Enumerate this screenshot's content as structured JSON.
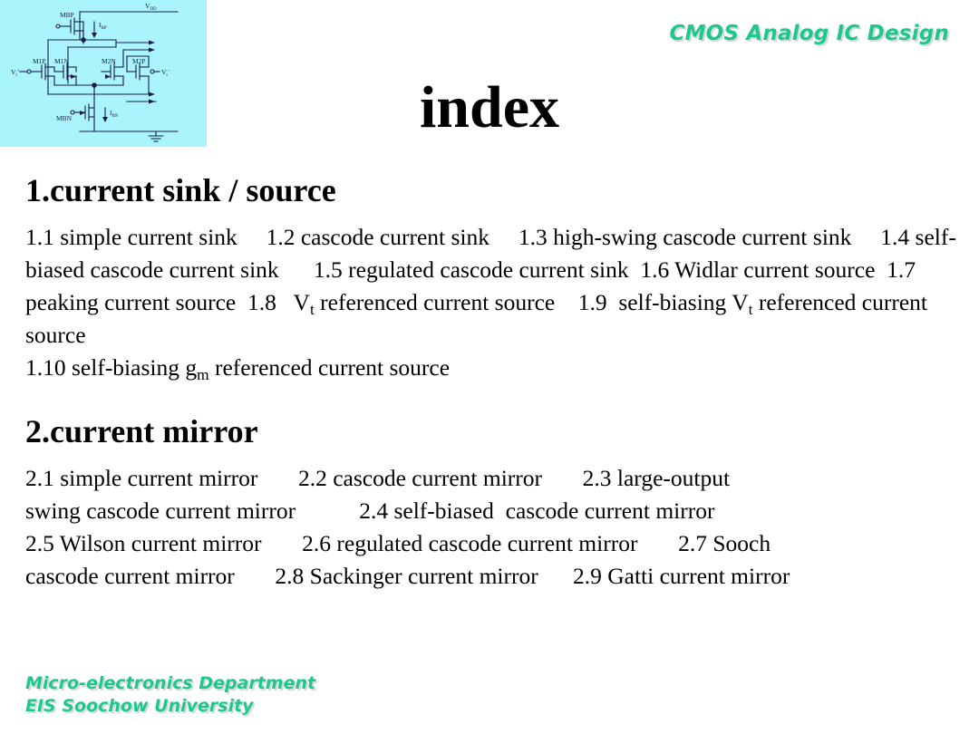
{
  "banner": {
    "course_title": "CMOS Analog IC Design",
    "accent_color": "#1ec88c",
    "shadow_color": "#d9d9d9"
  },
  "title": {
    "text": "index"
  },
  "thumbnail": {
    "name": "cmos-differential-amplifier-circuit",
    "background_color": "#aaf5fc",
    "labels": {
      "vdd": "V",
      "vdd_sub": "DD",
      "mbp": "MBP",
      "ibp": "I",
      "ibp_sub": "BP",
      "mbn": "MBN",
      "ibn": "I",
      "ibn_sub": "BN",
      "m1p": "M1P",
      "m1n": "M1N",
      "m2n": "M2N",
      "m2p": "M2P",
      "vin_plus": "V",
      "vin_plus_sub": "i",
      "vin_plus_sup": "+",
      "vin_minus": "V",
      "vin_minus_sub": "i",
      "vin_minus_sup": "–"
    }
  },
  "sections": [
    {
      "heading": "1.current sink / source",
      "body_lines": [
        "1.1 simple current sink     1.2 cascode current sink     1.3 high-swing cascode",
        "current sink     1.4 self-biased cascode current sink      1.5 regulated cascode",
        "current sink  1.6 Widlar current source  1.7 peaking current source  1.8   V",
        "referenced current source   1.9  self-biasing V",
        "1.10 self-biasing g"
      ],
      "topics": [
        "1.1 simple current sink",
        "1.2 cascode current sink",
        "1.3 high-swing cascode current sink",
        "1.4 self-biased cascode current sink",
        "1.5 regulated cascode current sink",
        "1.6 Widlar current source",
        "1.7 peaking current source",
        "1.8 Vt referenced current source",
        "1.9 self-biasing Vt referenced current source",
        "1.10 self-biasing gm referenced current source"
      ]
    },
    {
      "heading": "2.current mirror",
      "body_lines": [
        "2.1 simple current mirror       2.2 cascode current mirror       2.3 large-output",
        "swing cascode current mirror           2.4 self-biased  cascode current mirror",
        "2.5 Wilson current mirror       2.6 regulated cascode current mirror       2.7 Sooch",
        "cascode current mirror       2.8 Sackinger current mirror      2.9 Gatti current mirror"
      ],
      "topics": [
        "2.1 simple current mirror",
        "2.2 cascode current mirror",
        "2.3 large-output swing cascode current mirror",
        "2.4 self-biased cascode current mirror",
        "2.5 Wilson current mirror",
        "2.6 regulated cascode current mirror",
        "2.7 Sooch cascode current mirror",
        "2.8 Sackinger current mirror",
        "2.9 Gatti current mirror"
      ]
    }
  ],
  "section1_inline": {
    "seg_a": "1.1 simple current sink     1.2 cascode current sink     1.3 high-swing cascode current sink     1.4 self-biased cascode current sink      1.5 regulated cascode current sink  1.6 Widlar current source  1.7 peaking current source  1.8   V",
    "sub_t1": "t",
    "seg_b": " referenced current source    1.9  self-biasing V",
    "sub_t2": "t",
    "seg_c": " referenced current source",
    "seg_d": "1.10 self-biasing g",
    "sub_m": "m",
    "seg_e": " referenced current source"
  },
  "footer": {
    "line1": "Micro-electronics Department",
    "line2": "EIS Soochow University"
  }
}
